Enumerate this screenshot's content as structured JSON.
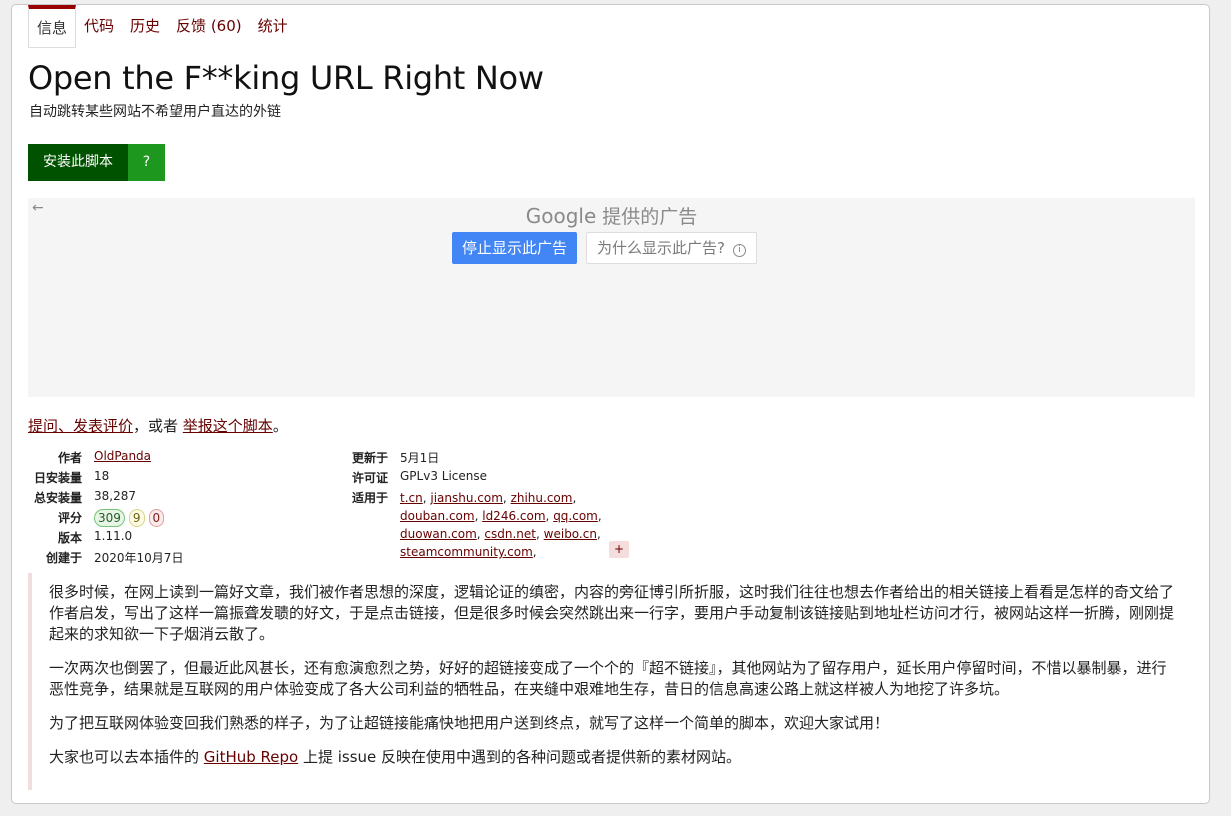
{
  "tabs": [
    "信息",
    "代码",
    "历史",
    "反馈 (60)",
    "统计"
  ],
  "title": "Open the F**king URL Right Now",
  "subtitle": "自动跳转某些网站不希望用户直达的外链",
  "install": {
    "label": "安装此脚本",
    "help": "?"
  },
  "ad": {
    "back": "←",
    "brand": "Google",
    "title": "提供的广告",
    "stop": "停止显示此广告",
    "why": "为什么显示此广告?",
    "info_icon": "ⓘ"
  },
  "feedback": {
    "link1": "提问、发表评价",
    "mid": "，或者 ",
    "link2": "举报这个脚本",
    "end": "。"
  },
  "meta": {
    "author_label": "作者",
    "author": "OldPanda",
    "daily_label": "日安装量",
    "daily": "18",
    "total_label": "总安装量",
    "total": "38,287",
    "rating_label": "评分",
    "rating_good": "309",
    "rating_ok": "9",
    "rating_bad": "0",
    "version_label": "版本",
    "version": "1.11.0",
    "created_label": "创建于",
    "created": "2020年10月7日",
    "updated_label": "更新于",
    "updated": "5月1日",
    "license_label": "许可证",
    "license": "GPLv3 License",
    "applies_label": "适用于",
    "applies": [
      "t.cn",
      "jianshu.com",
      "zhihu.com",
      "douban.com",
      "ld246.com",
      "qq.com",
      "duowan.com",
      "csdn.net",
      "weibo.cn",
      "steamcommunity.com"
    ],
    "more": "+"
  },
  "description": {
    "p1": "很多时候，在网上读到一篇好文章，我们被作者思想的深度，逻辑论证的缜密，内容的旁征博引所折服，这时我们往往也想去作者给出的相关链接上看看是怎样的奇文给了作者启发，写出了这样一篇振聋发聩的好文，于是点击链接，但是很多时候会突然跳出来一行字，要用户手动复制该链接贴到地址栏访问才行，被网站这样一折腾，刚刚提起来的求知欲一下子烟消云散了。",
    "p2": "一次两次也倒罢了，但最近此风甚长，还有愈演愈烈之势，好好的超链接变成了一个个的『超不链接』，其他网站为了留存用户，延长用户停留时间，不惜以暴制暴，进行恶性竞争，结果就是互联网的用户体验变成了各大公司利益的牺牲品，在夹缝中艰难地生存，昔日的信息高速公路上就这样被人为地挖了许多坑。",
    "p3": "为了把互联网体验变回我们熟悉的样子，为了让超链接能痛快地把用户送到终点，就写了这样一个简单的脚本，欢迎大家试用！",
    "p4_before": "大家也可以去本插件的 ",
    "p4_link": "GitHub Repo",
    "p4_after": " 上提 issue 反映在使用中遇到的各种问题或者提供新的素材网站。"
  }
}
